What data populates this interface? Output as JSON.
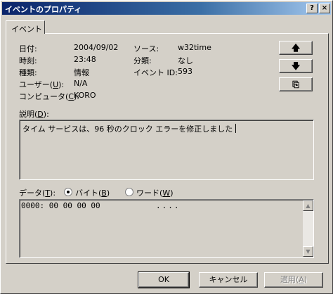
{
  "window": {
    "title": "イベントのプロパティ",
    "help_glyph": "?",
    "close_glyph": "×"
  },
  "tab": {
    "label": "イベント"
  },
  "fields": {
    "date_label": "日付:",
    "date_value": "2004/09/02",
    "time_label": "時刻:",
    "time_value": "23:48",
    "type_label": "種類:",
    "type_value": "情報",
    "user_label": "ユーザー",
    "user_key": "U",
    "user_value": "N/A",
    "computer_label": "コンピュータ",
    "computer_key": "C",
    "computer_value": "KORO",
    "source_label": "ソース:",
    "source_value": "w32time",
    "category_label": "分類:",
    "category_value": "なし",
    "event_id_label": "イベント ID:",
    "event_id_value": "593"
  },
  "nav_buttons": {
    "up_glyph": "🡅",
    "down_glyph": "🡇",
    "copy_glyph": "⎘"
  },
  "description": {
    "label": "説明",
    "key": "D",
    "text": "タイム サービスは、96 秒のクロック エラーを修正しました"
  },
  "data_section": {
    "label": "データ",
    "key": "T",
    "bytes_label": "バイト",
    "bytes_key": "B",
    "words_label": "ワード",
    "words_key": "W",
    "hex_line": "0000: 00 00 00 00",
    "ascii_line": "...."
  },
  "buttons": {
    "ok": "OK",
    "cancel": "キャンセル",
    "apply": "適用",
    "apply_key": "A"
  }
}
